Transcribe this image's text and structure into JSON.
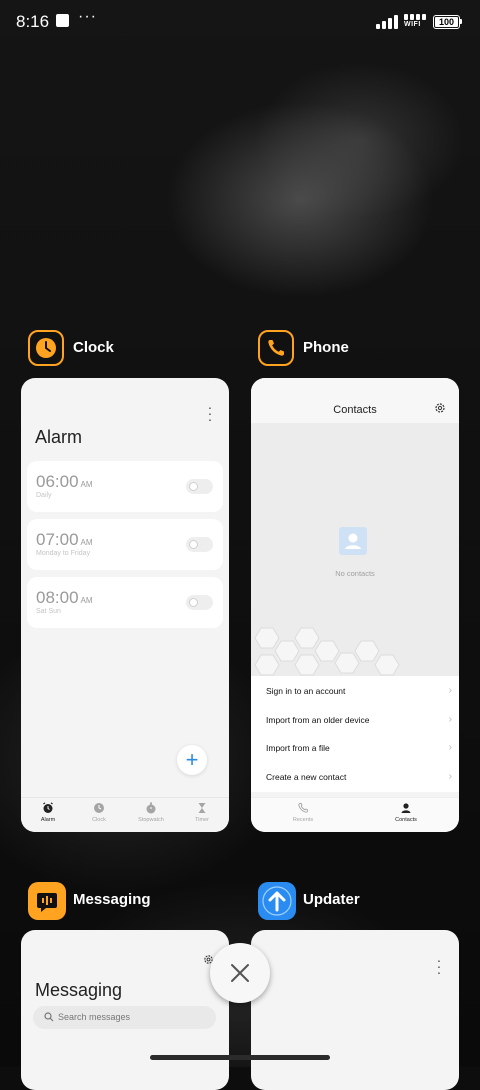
{
  "status_bar": {
    "time": "8:16",
    "wifi_label": "WIFI",
    "battery": "100"
  },
  "recents": [
    {
      "app_name": "Clock",
      "icon": "clock-icon",
      "screen": {
        "title": "Alarm",
        "alarms": [
          {
            "time": "06:00",
            "ampm": "AM",
            "repeat": "Daily"
          },
          {
            "time": "07:00",
            "ampm": "AM",
            "repeat": "Monday to Friday"
          },
          {
            "time": "08:00",
            "ampm": "AM",
            "repeat": "Sat Sun"
          }
        ],
        "tabs": [
          "Alarm",
          "Clock",
          "Stopwatch",
          "Timer"
        ],
        "active_tab": "Alarm"
      }
    },
    {
      "app_name": "Phone",
      "icon": "phone-icon",
      "screen": {
        "title": "Contacts",
        "empty_text": "No contacts",
        "options": [
          "Sign in to an account",
          "Import from an older device",
          "Import from a file",
          "Create a new contact"
        ],
        "tabs": [
          "Recents",
          "Contacts"
        ],
        "active_tab": "Contacts"
      }
    },
    {
      "app_name": "Messaging",
      "icon": "messaging-icon",
      "screen": {
        "title": "Messaging",
        "search_placeholder": "Search messages"
      }
    },
    {
      "app_name": "Updater",
      "icon": "updater-icon",
      "screen": {}
    }
  ],
  "colors": {
    "accent_orange": "#ffa320",
    "updater_blue": "#2a8cf0",
    "fab_blue": "#2c8be0"
  }
}
